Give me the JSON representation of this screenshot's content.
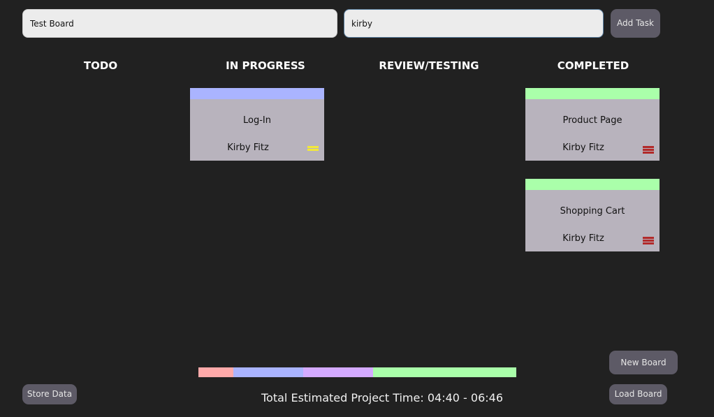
{
  "header": {
    "board_name_value": "Test Board",
    "search_value": "kirby",
    "add_task_label": "Add Task"
  },
  "columns": [
    {
      "title": "TODO"
    },
    {
      "title": "IN PROGRESS"
    },
    {
      "title": "REVIEW/TESTING"
    },
    {
      "title": "COMPLETED"
    }
  ],
  "cards": [
    {
      "column": "IN PROGRESS",
      "title": "Log-In",
      "assignee": "Kirby Fitz",
      "strip_color": "#aab4ff",
      "priority_color": "#f2e83a",
      "priority_bars": 2
    },
    {
      "column": "COMPLETED",
      "title": "Product Page",
      "assignee": "Kirby Fitz",
      "strip_color": "#aaffaa",
      "priority_color": "#b22a2a",
      "priority_bars": 3
    },
    {
      "column": "COMPLETED",
      "title": "Shopping Cart",
      "assignee": "Kirby Fitz",
      "strip_color": "#aaffaa",
      "priority_color": "#b22a2a",
      "priority_bars": 3
    }
  ],
  "progress_bar": {
    "segments": [
      {
        "color": "#ffaaaa",
        "fraction": 0.11
      },
      {
        "color": "#aab4ff",
        "fraction": 0.22
      },
      {
        "color": "#d4aaff",
        "fraction": 0.22
      },
      {
        "color": "#aaffaa",
        "fraction": 0.45
      }
    ]
  },
  "footer": {
    "total_time": "Total Estimated Project Time: 04:40 - 06:46",
    "store_data_label": "Store Data",
    "new_board_label": "New Board",
    "load_board_label": "Load Board"
  }
}
